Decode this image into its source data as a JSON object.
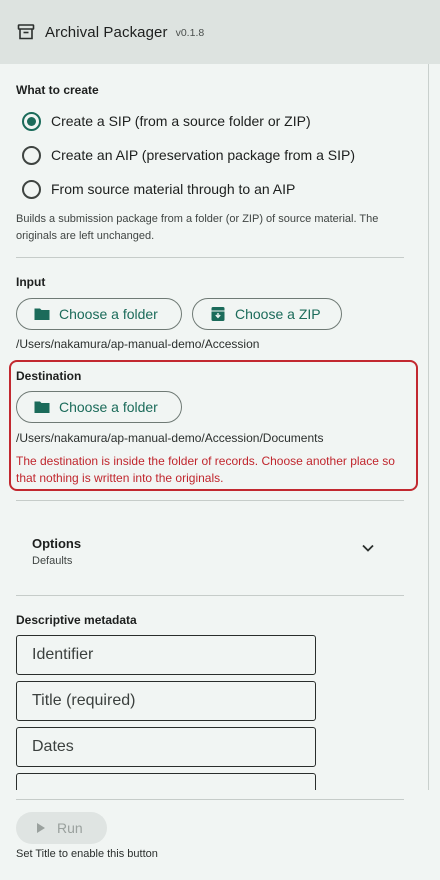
{
  "header": {
    "title": "Archival Packager",
    "version": "v0.1.8",
    "icon": "archive-box-icon"
  },
  "mode": {
    "title": "What to create",
    "options": [
      {
        "label": "Create a SIP (from a source folder or ZIP)",
        "selected": true
      },
      {
        "label": "Create an AIP (preservation package from a SIP)",
        "selected": false
      },
      {
        "label": "From source material through to an AIP",
        "selected": false
      }
    ],
    "helper": "Builds a submission package from a folder (or ZIP) of source material. The originals are left unchanged."
  },
  "input": {
    "title": "Input",
    "choose_folder_label": "Choose a folder",
    "choose_zip_label": "Choose a ZIP",
    "path": "/Users/nakamura/ap-manual-demo/Accession"
  },
  "destination": {
    "title": "Destination",
    "choose_folder_label": "Choose a folder",
    "path": "/Users/nakamura/ap-manual-demo/Accession/Documents",
    "error": "The destination is inside the folder of records. Choose another place so that nothing is written into the originals.",
    "error_color": "#c0262d"
  },
  "options": {
    "title": "Options",
    "subtitle": "Defaults"
  },
  "metadata": {
    "title": "Descriptive metadata",
    "fields": [
      {
        "placeholder": "Identifier"
      },
      {
        "placeholder": "Title (required)"
      },
      {
        "placeholder": "Dates"
      },
      {
        "placeholder": ""
      }
    ]
  },
  "footer": {
    "run_label": "Run",
    "run_hint": "Set Title to enable this button"
  },
  "colors": {
    "accent": "#1b6b5a",
    "header_bg": "#dde3e0",
    "page_bg": "#f1f5f3"
  }
}
